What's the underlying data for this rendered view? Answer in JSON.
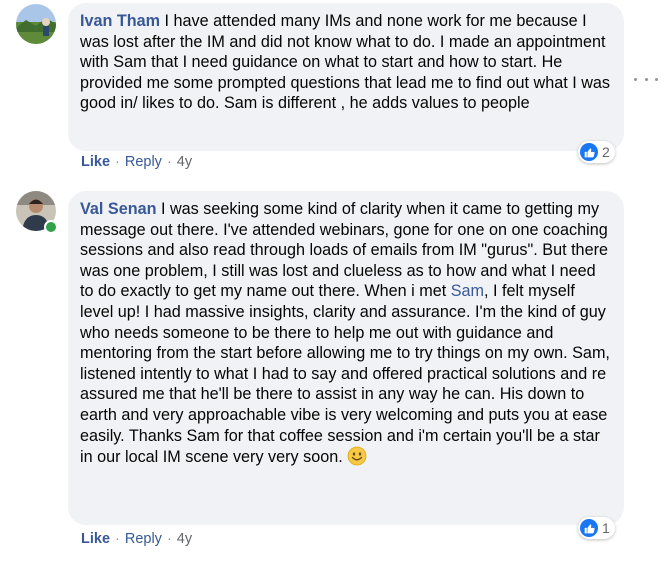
{
  "comments": [
    {
      "author": "Ivan Tham",
      "text": " I have attended many IMs and none work for me because I was lost after the IM and did not know what to do. I made an appointment with Sam that I need guidance on what to start and how to start. He provided me some prompted questions that lead me to find out what I was good in/ likes to do. Sam is different , he adds values to people",
      "reaction_count": "2",
      "like_label": "Like",
      "reply_label": "Reply",
      "time": "4y"
    },
    {
      "author": "Val Senan",
      "text_before_mention": " I was seeking some kind of clarity when it came to getting my message out there. I've attended webinars, gone for one on one coaching sessions and also read through loads of emails from IM \"gurus\". But there was one problem, I still was lost and clueless as to how and what I need to do exactly to get my name out there. When i met ",
      "mention": "Sam",
      "text_after_mention": ", I felt myself level up! I had massive insights, clarity and assurance. I'm the kind of guy who needs someone to be there to help me out with guidance and mentoring from the start before allowing me to try things on my own. Sam, listened intently to what I had to say and offered practical solutions and re assured me that he'll be there to assist in any way he can. His down to earth and very approachable vibe is very welcoming and puts you at ease easily. Thanks Sam for that coffee session and i'm certain you'll be a star in our local IM scene very very soon. ",
      "emoji": "smiling-face-icon",
      "reaction_count": "1",
      "like_label": "Like",
      "reply_label": "Reply",
      "time": "4y",
      "online": true
    }
  ],
  "colors": {
    "bubble": "#f0f2f5",
    "author": "#385898",
    "meta": "#65676b",
    "like_blue": "#1877f2",
    "online_green": "#31a24c"
  }
}
